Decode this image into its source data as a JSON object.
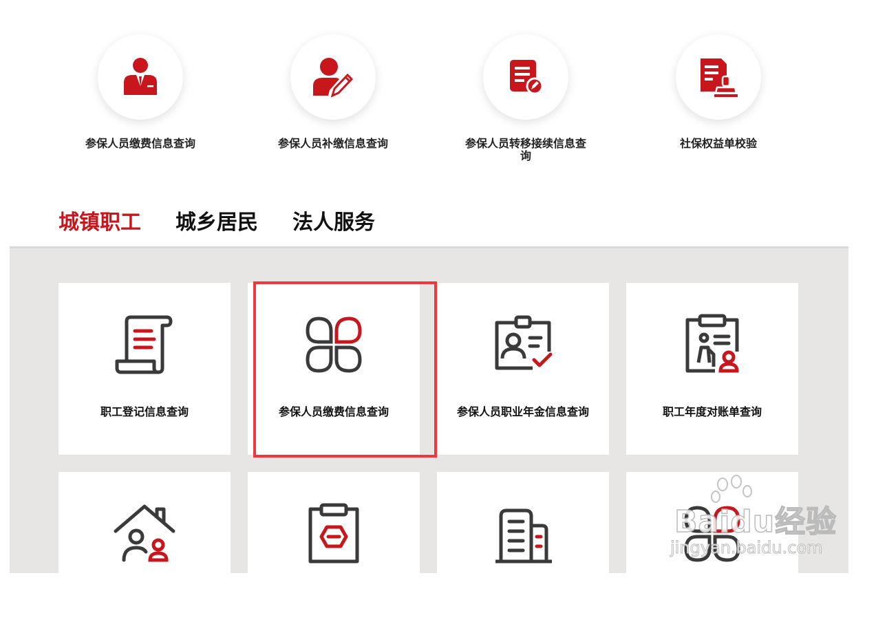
{
  "quick_links": [
    {
      "label": "参保人员缴费信息查询",
      "icon": "employee-person-icon"
    },
    {
      "label": "参保人员补缴信息查询",
      "icon": "person-edit-icon"
    },
    {
      "label": "参保人员转移接续信息查询",
      "icon": "document-edit-icon"
    },
    {
      "label": "社保权益单校验",
      "icon": "document-stamp-icon"
    }
  ],
  "tabs": [
    {
      "label": "城镇职工",
      "active": true
    },
    {
      "label": "城乡居民",
      "active": false
    },
    {
      "label": "法人服务",
      "active": false
    }
  ],
  "services": [
    {
      "label": "职工登记信息查询",
      "icon": "scroll-document-icon"
    },
    {
      "label": "参保人员缴费信息查询",
      "icon": "four-petal-icon",
      "highlighted": true
    },
    {
      "label": "参保人员职业年金信息查询",
      "icon": "id-badge-icon"
    },
    {
      "label": "职工年度对账单查询",
      "icon": "clipboard-elder-icon"
    },
    {
      "label": "",
      "icon": "house-persons-icon"
    },
    {
      "label": "",
      "icon": "clipboard-hexagon-icon"
    },
    {
      "label": "",
      "icon": "office-buildings-icon"
    },
    {
      "label": "",
      "icon": "four-petal-icon"
    }
  ],
  "watermark": {
    "main": "Baidu经验",
    "sub": "jingyan.baidu.com"
  },
  "colors": {
    "accent": "#c8161d",
    "highlight": "#f0383c",
    "panel": "#e7e6e5",
    "icon_dark": "#3a3a3a"
  }
}
